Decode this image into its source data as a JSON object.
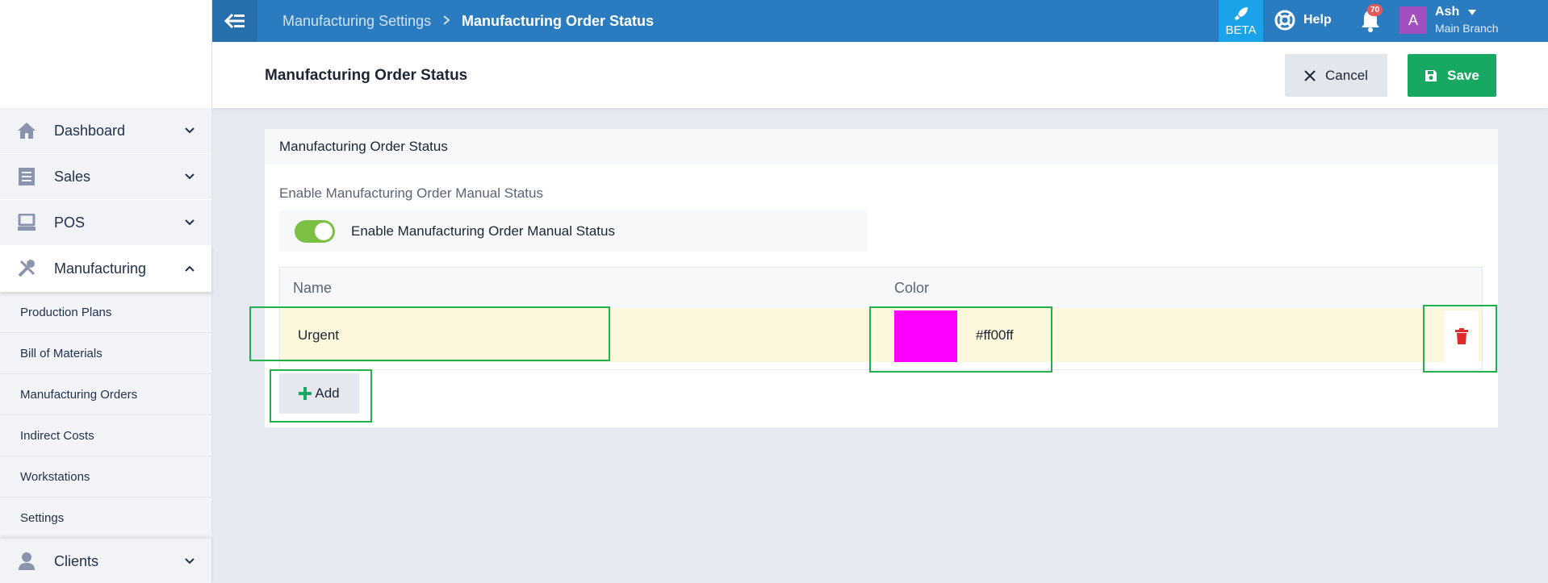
{
  "topbar": {
    "breadcrumb_parent": "Manufacturing Settings",
    "breadcrumb_current": "Manufacturing Order Status",
    "beta_label": "BETA",
    "help_label": "Help",
    "notification_count": "70",
    "user_initial": "A",
    "user_name": "Ash",
    "user_branch": "Main Branch"
  },
  "sidebar": {
    "items": [
      {
        "label": "Dashboard",
        "icon": "home-icon"
      },
      {
        "label": "Sales",
        "icon": "receipt-icon"
      },
      {
        "label": "POS",
        "icon": "pos-terminal-icon"
      },
      {
        "label": "Manufacturing",
        "icon": "tools-icon"
      }
    ],
    "sub_items": [
      "Production Plans",
      "Bill of Materials",
      "Manufacturing Orders",
      "Indirect Costs",
      "Workstations",
      "Settings"
    ],
    "after_items": [
      {
        "label": "Clients",
        "icon": "client-icon"
      }
    ]
  },
  "header": {
    "title": "Manufacturing Order Status",
    "cancel_label": "Cancel",
    "save_label": "Save"
  },
  "card": {
    "title": "Manufacturing Order Status",
    "section_label": "Enable Manufacturing Order Manual Status",
    "toggle_label": "Enable Manufacturing Order Manual Status",
    "toggle_on": true,
    "table": {
      "columns": [
        "Name",
        "Color"
      ],
      "rows": [
        {
          "name": "Urgent",
          "color": "#ff00ff"
        }
      ]
    },
    "add_label": "Add"
  },
  "colors": {
    "topbar": "#2a7bbf",
    "save": "#17a862",
    "delete": "#e02b2b",
    "highlight": "#22b04b",
    "row_bg": "#fdf8dc",
    "swatch": "#ff00ff"
  }
}
